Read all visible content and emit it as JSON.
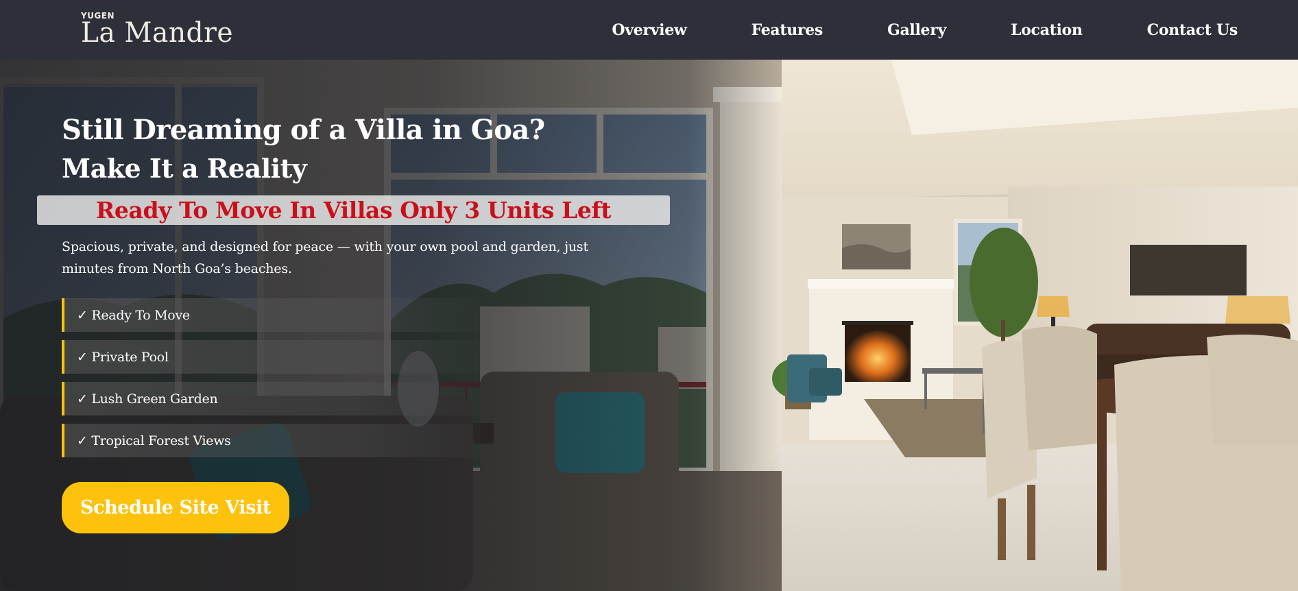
{
  "nav": {
    "logo": {
      "brand_top": "YUGEN",
      "brand_name": "La Mandre"
    },
    "items": [
      {
        "label": "Overview"
      },
      {
        "label": "Features"
      },
      {
        "label": "Gallery"
      },
      {
        "label": "Location"
      },
      {
        "label": "Contact Us"
      }
    ]
  },
  "hero": {
    "headline": "Still Dreaming of a Villa in Goa?",
    "subheadline": "Make It a Reality",
    "promo": "Ready To Move In Villas Only 3 Units Left",
    "description": "Spacious, private, and designed for peace — with your own pool and garden, just minutes from North Goa’s beaches.",
    "features": [
      {
        "label": "✓ Ready To Move"
      },
      {
        "label": "✓ Private Pool"
      },
      {
        "label": "✓ Lush Green Garden"
      },
      {
        "label": "✓ Tropical Forest Views"
      }
    ],
    "cta_label": "Schedule Site Visit"
  },
  "colors": {
    "nav_bg": "#2d3039",
    "accent": "#ffc20c",
    "promo_text": "#c9101a"
  }
}
